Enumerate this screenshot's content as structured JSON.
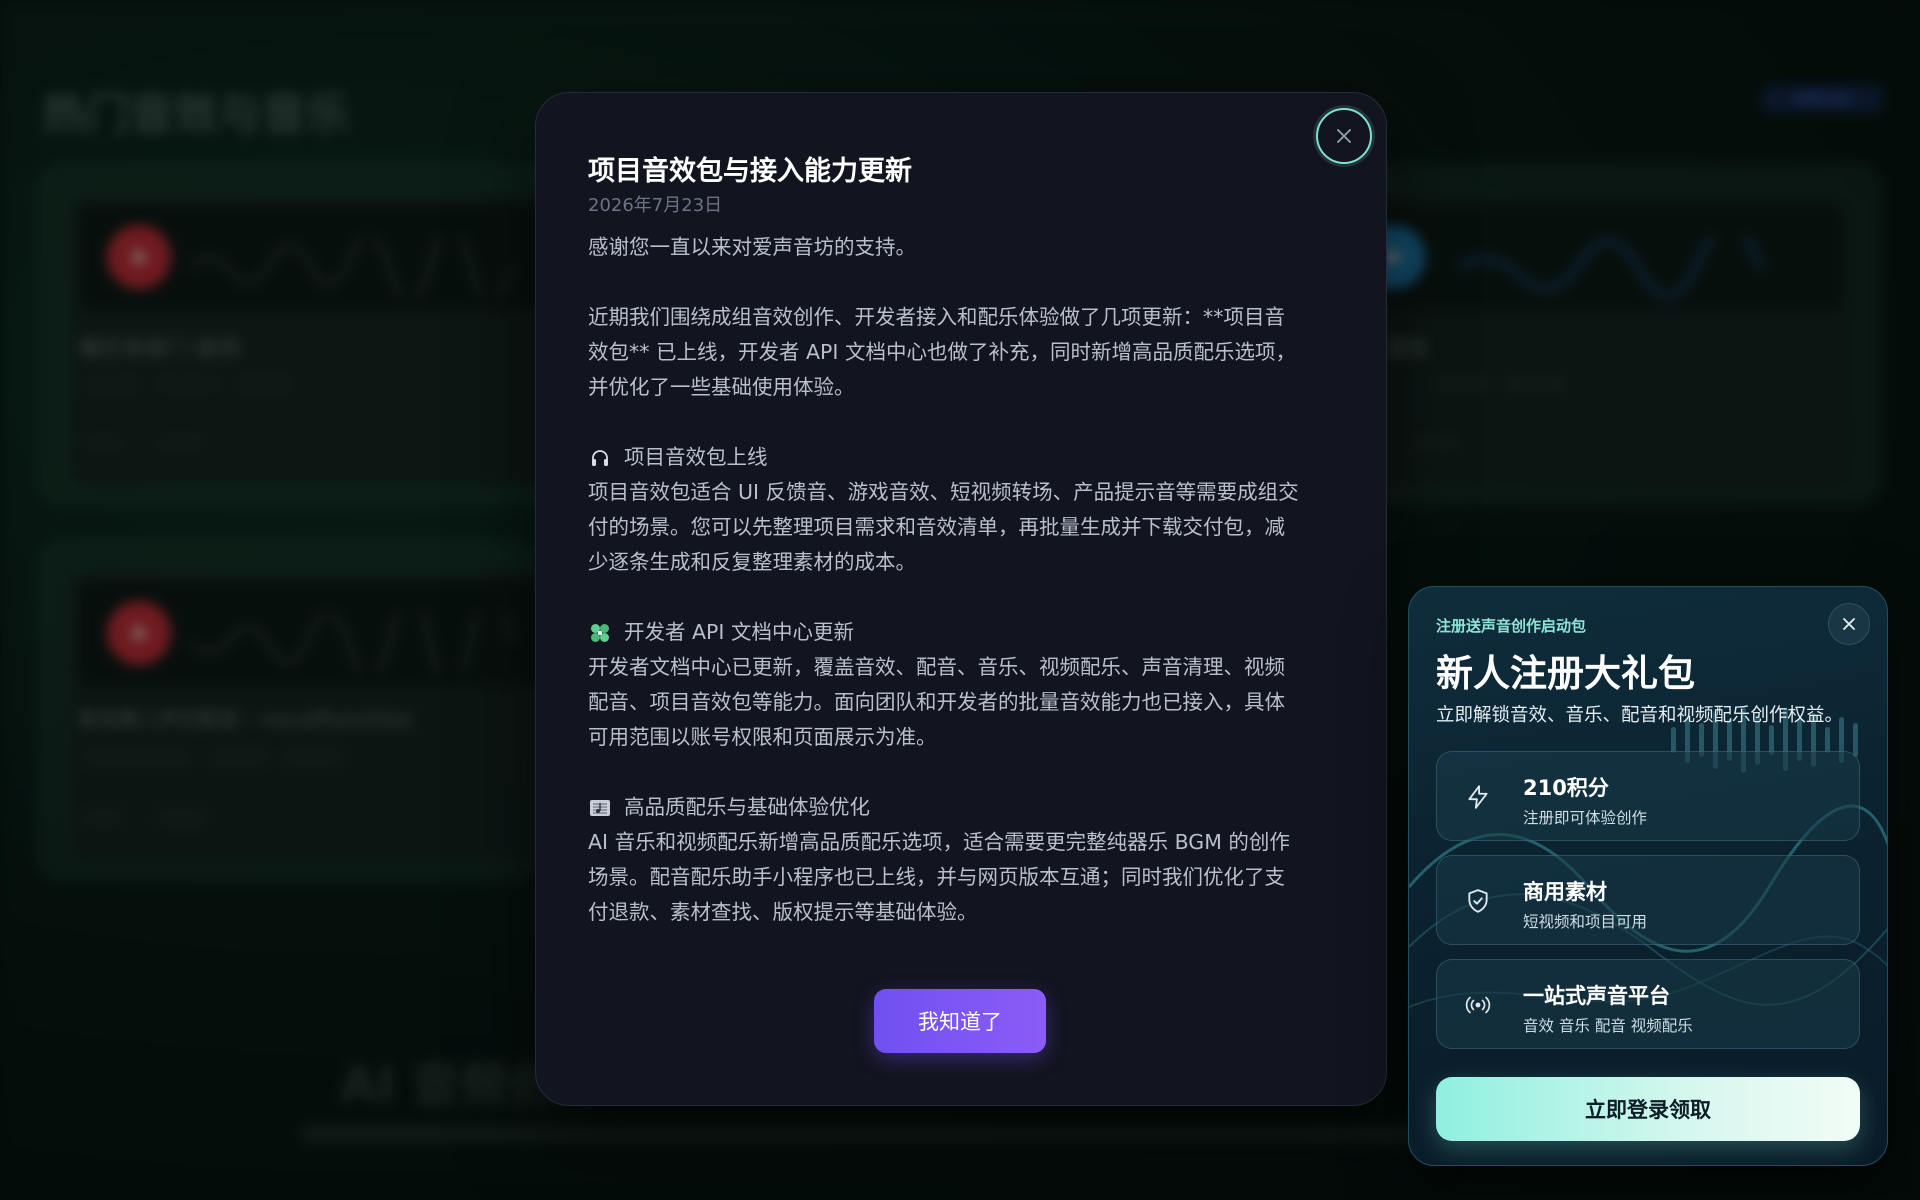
{
  "background": {
    "heading": "热门音效与音乐",
    "top_right": "查看全部",
    "cards": [
      {
        "title": "餐饮单周门 剧场"
      },
      {
        "title": "影视真人声乐配音 · vocalfunction"
      },
      {
        "title": "音效"
      }
    ],
    "hero": "AI 音频创作"
  },
  "modal": {
    "title": "项目音效包与接入能力更新",
    "date": "2026年7月23日",
    "intro": "感谢您一直以来对爱声音坊的支持。",
    "update_lines": [
      "近期我们围绕成组音效创作、开发者接入和配乐体验做了几项更新：**项目音",
      "效包** 已上线，开发者 API 文档中心也做了补充，同时新增高品质配乐选项，",
      "并优化了一些基础使用体验。"
    ],
    "sections": [
      {
        "icon": "headphones-icon",
        "heading": "项目音效包上线",
        "lines": [
          "项目音效包适合 UI 反馈音、游戏音效、短视频转场、产品提示音等需要成组交",
          "付的场景。您可以先整理项目需求和音效清单，再批量生成并下载交付包，减",
          "少逐条生成和反复整理素材的成本。"
        ]
      },
      {
        "icon": "puzzle-piece-icon",
        "heading": "开发者 API 文档中心更新",
        "lines": [
          "开发者文档中心已更新，覆盖音效、配音、音乐、视频配乐、声音清理、视频",
          "配音、项目音效包等能力。面向团队和开发者的批量音效能力也已接入，具体",
          "可用范围以账号权限和页面展示为准。"
        ]
      },
      {
        "icon": "music-score-icon",
        "heading": "高品质配乐与基础体验优化",
        "lines": [
          "AI 音乐和视频配乐新增高品质配乐选项，适合需要更完整纯器乐 BGM 的创作",
          "场景。配音配乐助手小程序也已上线，并与网页版本互通；同时我们优化了支",
          "付退款、素材查找、版权提示等基础体验。"
        ]
      }
    ],
    "ok_label": "我知道了",
    "accent": "#7c4dff"
  },
  "gift": {
    "kicker": "注册送声音创作启动包",
    "title": "新人注册大礼包",
    "subtitle": "立即解锁音效、音乐、配音和视频配乐创作权益。",
    "benefits": [
      {
        "icon": "lightning-icon",
        "title": "210积分",
        "desc": "注册即可体验创作"
      },
      {
        "icon": "shield-check-icon",
        "title": "商用素材",
        "desc": "短视频和项目可用"
      },
      {
        "icon": "broadcast-icon",
        "title": "一站式声音平台",
        "desc": "音效 音乐 配音 视频配乐"
      }
    ],
    "cta_label": "立即登录领取",
    "accent": "#8ff0e0"
  }
}
